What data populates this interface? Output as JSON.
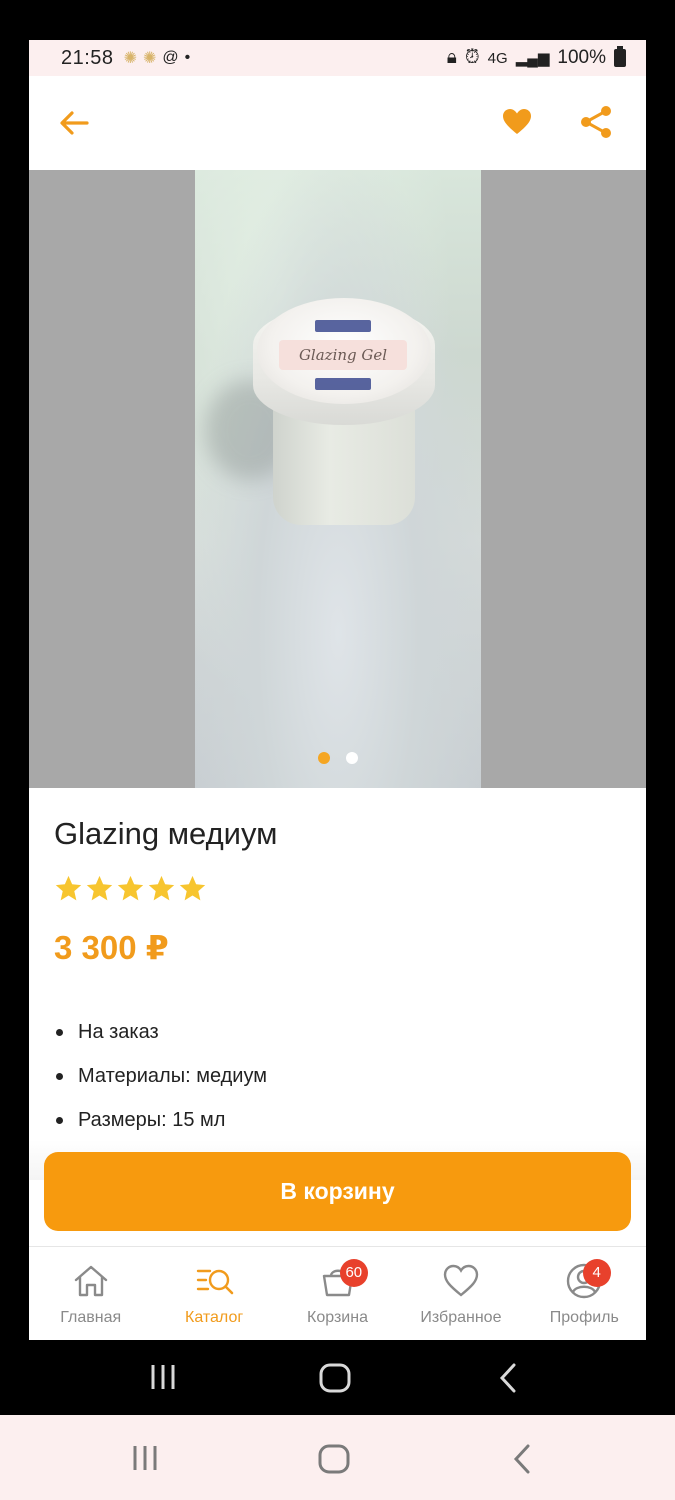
{
  "status_bar": {
    "time": "21:58",
    "at_symbol": "@",
    "dot": "•",
    "network": "4G",
    "battery": "100%"
  },
  "app_bar": {
    "back_icon": "arrow-left-icon",
    "favorite_icon": "heart-icon",
    "share_icon": "share-icon"
  },
  "gallery": {
    "image_label": "Glazing Gel",
    "slides": 2,
    "active_slide": 1
  },
  "product": {
    "title": "Glazing медиум",
    "rating": 5,
    "rating_max": 5,
    "price": "3 300 ₽",
    "properties": [
      "На заказ",
      "Материалы: медиум",
      "Размеры: 15 мл"
    ]
  },
  "actions": {
    "add_to_cart": "В корзину"
  },
  "bottom_nav": {
    "items": [
      {
        "label": "Главная",
        "icon": "home-icon",
        "active": false
      },
      {
        "label": "Каталог",
        "icon": "catalog-search-icon",
        "active": true
      },
      {
        "label": "Корзина",
        "icon": "cart-icon",
        "active": false,
        "badge": "60"
      },
      {
        "label": "Избранное",
        "icon": "heart-outline-icon",
        "active": false
      },
      {
        "label": "Профиль",
        "icon": "profile-icon",
        "active": false,
        "badge": "4"
      }
    ]
  },
  "colors": {
    "accent": "#f19b1c",
    "button": "#f79a0e",
    "badge": "#e8412c",
    "star": "#f7c52f"
  }
}
